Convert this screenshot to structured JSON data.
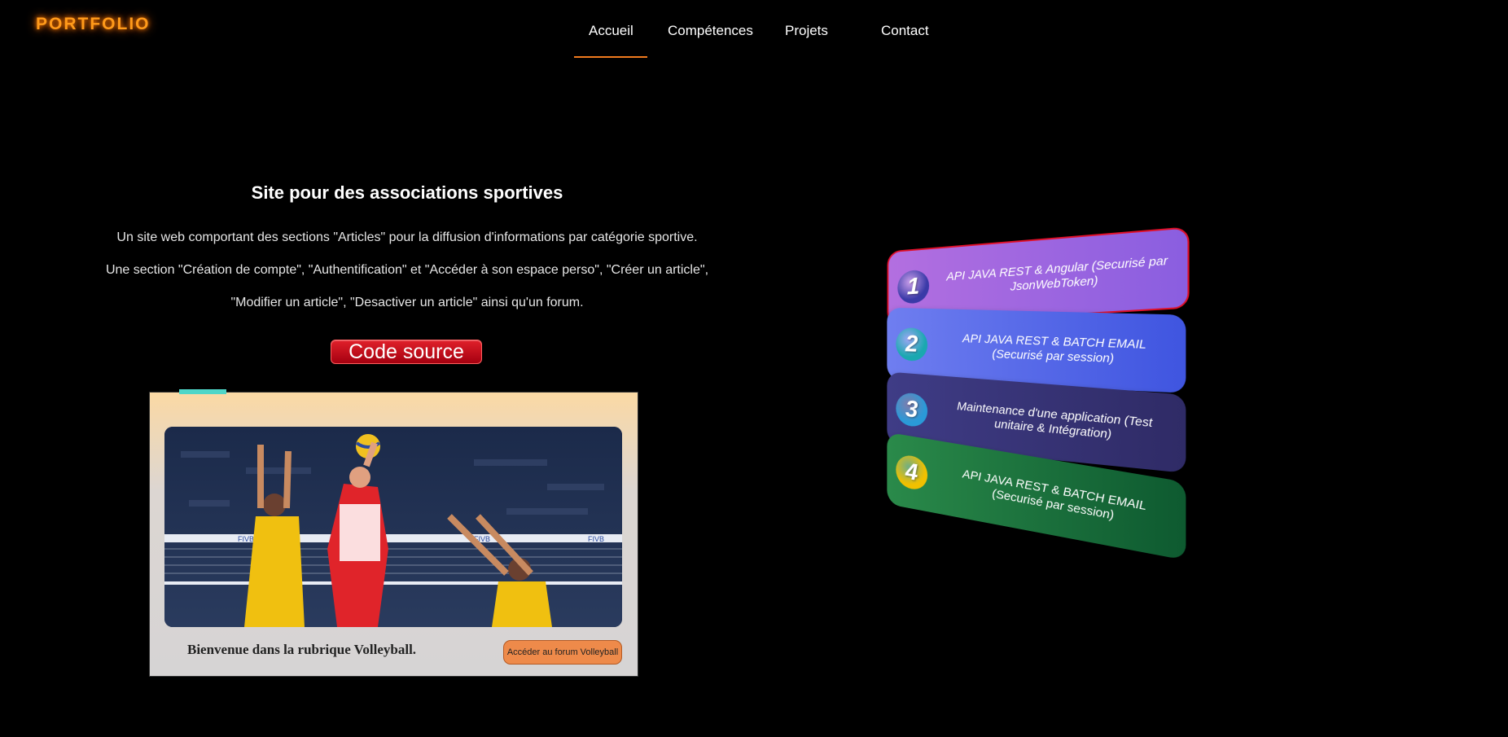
{
  "brand": {
    "logo": "PORTFOLIO"
  },
  "nav": {
    "items": [
      {
        "label": "Accueil",
        "active": true
      },
      {
        "label": "Compétences"
      },
      {
        "label": "Projets"
      },
      {
        "label": "Contact"
      }
    ]
  },
  "project": {
    "title": "Site pour des associations sportives",
    "description": [
      "Un site web comportant des sections \"Articles\" pour la diffusion d'informations par catégorie sportive.",
      "Une section \"Création de compte\", \"Authentification\" et \"Accéder à son espace perso\", \"Créer un article\",",
      "\"Modifier un article\", \"Desactiver un article\" ainsi qu'un forum."
    ],
    "source_button": "Code source",
    "preview": {
      "welcome": "Bienvenue dans la rubrique Volleyball.",
      "forum_button": "Accéder au forum Volleyball"
    }
  },
  "cards": [
    {
      "number": "1",
      "text": "API JAVA REST & Angular (Securisé par JsonWebToken)",
      "color_from": "#b36fe0",
      "color_to": "#8a5ee0",
      "badge": "#3a3aa8"
    },
    {
      "number": "2",
      "text": "API JAVA REST & BATCH EMAIL (Securisé par session)",
      "color_from": "#6f7ef0",
      "color_to": "#3f55e0",
      "badge": "#1aa8b0"
    },
    {
      "number": "3",
      "text": "Maintenance d'une application (Test unitaire & Intégration)",
      "color_from": "#3f3c86",
      "color_to": "#2f2b66",
      "badge": "#2a9ad8"
    },
    {
      "number": "4",
      "text": "API JAVA REST & BATCH EMAIL (Securisé par session)",
      "color_from": "#2a8a4a",
      "color_to": "#0e5a30",
      "badge": "#f0c000"
    }
  ]
}
